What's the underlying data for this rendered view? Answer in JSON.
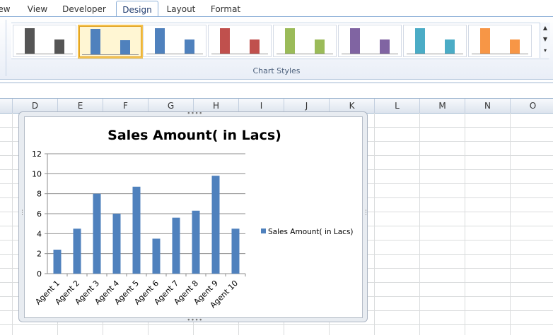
{
  "ribbon": {
    "tabs": [
      {
        "label": "ew",
        "active": false
      },
      {
        "label": "View",
        "active": false
      },
      {
        "label": "Developer",
        "active": false
      },
      {
        "label": "Design",
        "active": true
      },
      {
        "label": "Layout",
        "active": false
      },
      {
        "label": "Format",
        "active": false
      }
    ],
    "group_label": "Chart Styles",
    "style_colors": [
      "#555555",
      "#4f81bd",
      "#4f81bd",
      "#c0504d",
      "#9bbb59",
      "#8064a2",
      "#4bacc6",
      "#f79646"
    ],
    "selected_style_index": 1
  },
  "spreadsheet": {
    "columns": [
      "D",
      "E",
      "F",
      "G",
      "H",
      "I",
      "J",
      "K",
      "L",
      "M",
      "N",
      "O"
    ]
  },
  "chart_data": {
    "type": "bar",
    "title": "Sales Amount( in Lacs)",
    "categories": [
      "Agent 1",
      "Agent 2",
      "Agent 3",
      "Agent 4",
      "Agent 5",
      "Agent 6",
      "Agent 7",
      "Agent 8",
      "Agent 9",
      "Agent 10"
    ],
    "series": [
      {
        "name": "Sales Amount( in Lacs)",
        "values": [
          2.4,
          4.5,
          8.0,
          6.0,
          8.7,
          3.5,
          5.6,
          6.3,
          9.8,
          4.5
        ],
        "color": "#4f81bd"
      }
    ],
    "ylim": [
      0,
      12
    ],
    "yticks": [
      0,
      2,
      4,
      6,
      8,
      10,
      12
    ],
    "grid": true,
    "legend": "right"
  }
}
